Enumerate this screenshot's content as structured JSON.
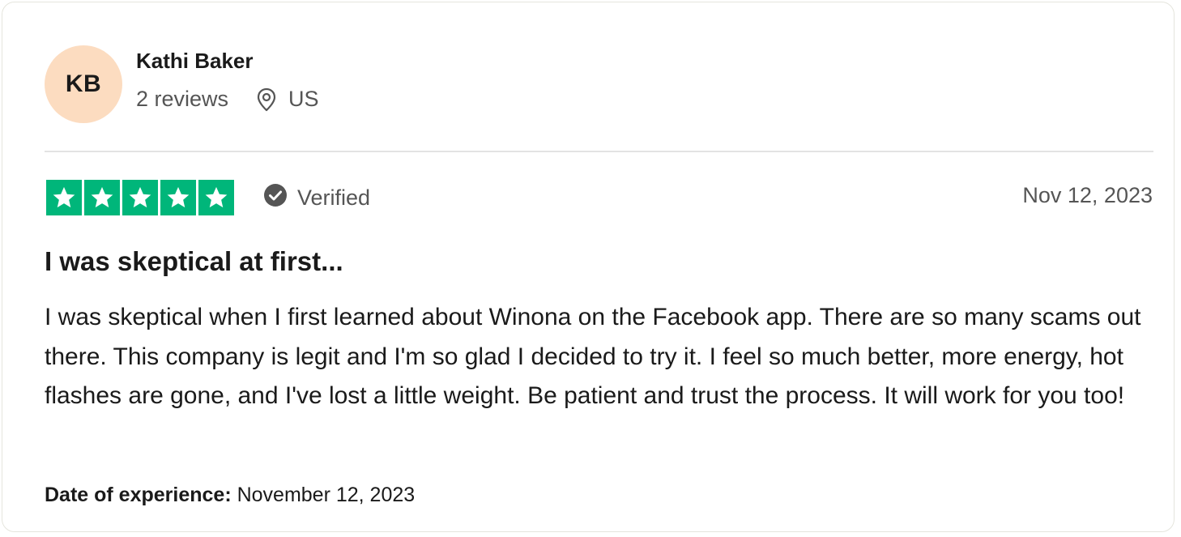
{
  "reviewer": {
    "initials": "KB",
    "name": "Kathi Baker",
    "reviews_count": "2 reviews",
    "location": "US"
  },
  "review": {
    "rating": 5,
    "rating_max": 5,
    "verified_label": "Verified",
    "date": "Nov 12, 2023",
    "title": "I was skeptical at first...",
    "body": "I was skeptical when I first learned about Winona on the Facebook app. There are so many scams out there. This company is legit and I'm so glad I decided to try it. I feel so much better, more energy, hot flashes are gone, and I've lost a little weight. Be patient and trust the process. It will work for you too!",
    "experience_label": "Date of experience:",
    "experience_date": "November 12, 2023"
  },
  "icons": {
    "location": "location-pin-icon",
    "verified": "verified-check-icon",
    "star": "star-icon"
  },
  "colors": {
    "star_green": "#00b67a",
    "avatar_bg": "#fcdcc0",
    "muted_text": "#555555",
    "verified_badge": "#555555"
  }
}
